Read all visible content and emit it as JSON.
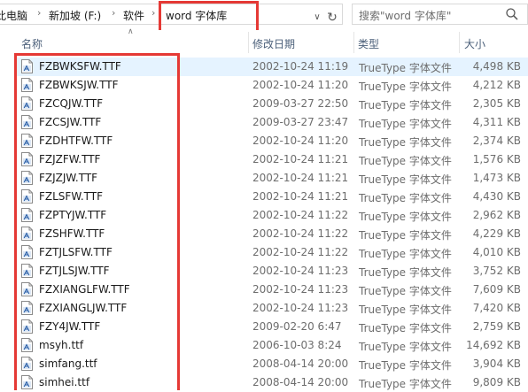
{
  "address_bar": {
    "crumbs": [
      "此电脑",
      "新加坡 (F:)",
      "软件",
      "word  字体库"
    ],
    "separator_icon": "chevron-right-icon",
    "dropdown_icon": "chevron-down-icon",
    "refresh_icon": "refresh-icon"
  },
  "search": {
    "placeholder": "搜索\"word  字体库\"",
    "icon": "search-icon"
  },
  "columns": {
    "name": "名称",
    "date": "修改日期",
    "type": "类型",
    "size": "大小"
  },
  "files": [
    {
      "name": "FZBWKSFW.TTF",
      "date": "2002-10-24 11:19",
      "type": "TrueType 字体文件",
      "size": "4,498 KB",
      "selected": true
    },
    {
      "name": "FZBWKSJW.TTF",
      "date": "2002-10-24 11:20",
      "type": "TrueType 字体文件",
      "size": "4,212 KB"
    },
    {
      "name": "FZCQJW.TTF",
      "date": "2009-03-27 22:50",
      "type": "TrueType 字体文件",
      "size": "2,305 KB"
    },
    {
      "name": "FZCSJW.TTF",
      "date": "2009-03-27 23:47",
      "type": "TrueType 字体文件",
      "size": "4,311 KB"
    },
    {
      "name": "FZDHTFW.TTF",
      "date": "2002-10-24 11:20",
      "type": "TrueType 字体文件",
      "size": "2,374 KB"
    },
    {
      "name": "FZJZFW.TTF",
      "date": "2002-10-24 11:21",
      "type": "TrueType 字体文件",
      "size": "1,576 KB"
    },
    {
      "name": "FZJZJW.TTF",
      "date": "2002-10-24 11:21",
      "type": "TrueType 字体文件",
      "size": "1,473 KB"
    },
    {
      "name": "FZLSFW.TTF",
      "date": "2002-10-24 11:21",
      "type": "TrueType 字体文件",
      "size": "4,430 KB"
    },
    {
      "name": "FZPTYJW.TTF",
      "date": "2002-10-24 11:22",
      "type": "TrueType 字体文件",
      "size": "2,962 KB"
    },
    {
      "name": "FZSHFW.TTF",
      "date": "2002-10-24 11:22",
      "type": "TrueType 字体文件",
      "size": "4,229 KB"
    },
    {
      "name": "FZTJLSFW.TTF",
      "date": "2002-10-24 11:22",
      "type": "TrueType 字体文件",
      "size": "4,010 KB"
    },
    {
      "name": "FZTJLSJW.TTF",
      "date": "2002-10-24 11:23",
      "type": "TrueType 字体文件",
      "size": "3,752 KB"
    },
    {
      "name": "FZXIANGLFW.TTF",
      "date": "2002-10-24 11:23",
      "type": "TrueType 字体文件",
      "size": "7,609 KB"
    },
    {
      "name": "FZXIANGLJW.TTF",
      "date": "2002-10-24 11:23",
      "type": "TrueType 字体文件",
      "size": "7,420 KB"
    },
    {
      "name": "FZY4JW.TTF",
      "date": "2009-02-20 6:47",
      "type": "TrueType 字体文件",
      "size": "2,759 KB"
    },
    {
      "name": "msyh.ttf",
      "date": "2006-10-03 8:24",
      "type": "TrueType 字体文件",
      "size": "14,692 KB"
    },
    {
      "name": "simfang.ttf",
      "date": "2008-04-14 20:00",
      "type": "TrueType 字体文件",
      "size": "3,904 KB"
    },
    {
      "name": "simhei.ttf",
      "date": "2008-04-14 20:00",
      "type": "TrueType 字体文件",
      "size": "9,809 KB"
    }
  ],
  "file_icon": "font-file-icon",
  "colors": {
    "selection": "#e5f3ff",
    "annotation_box": "#e53935",
    "header_text": "#4c607a"
  }
}
